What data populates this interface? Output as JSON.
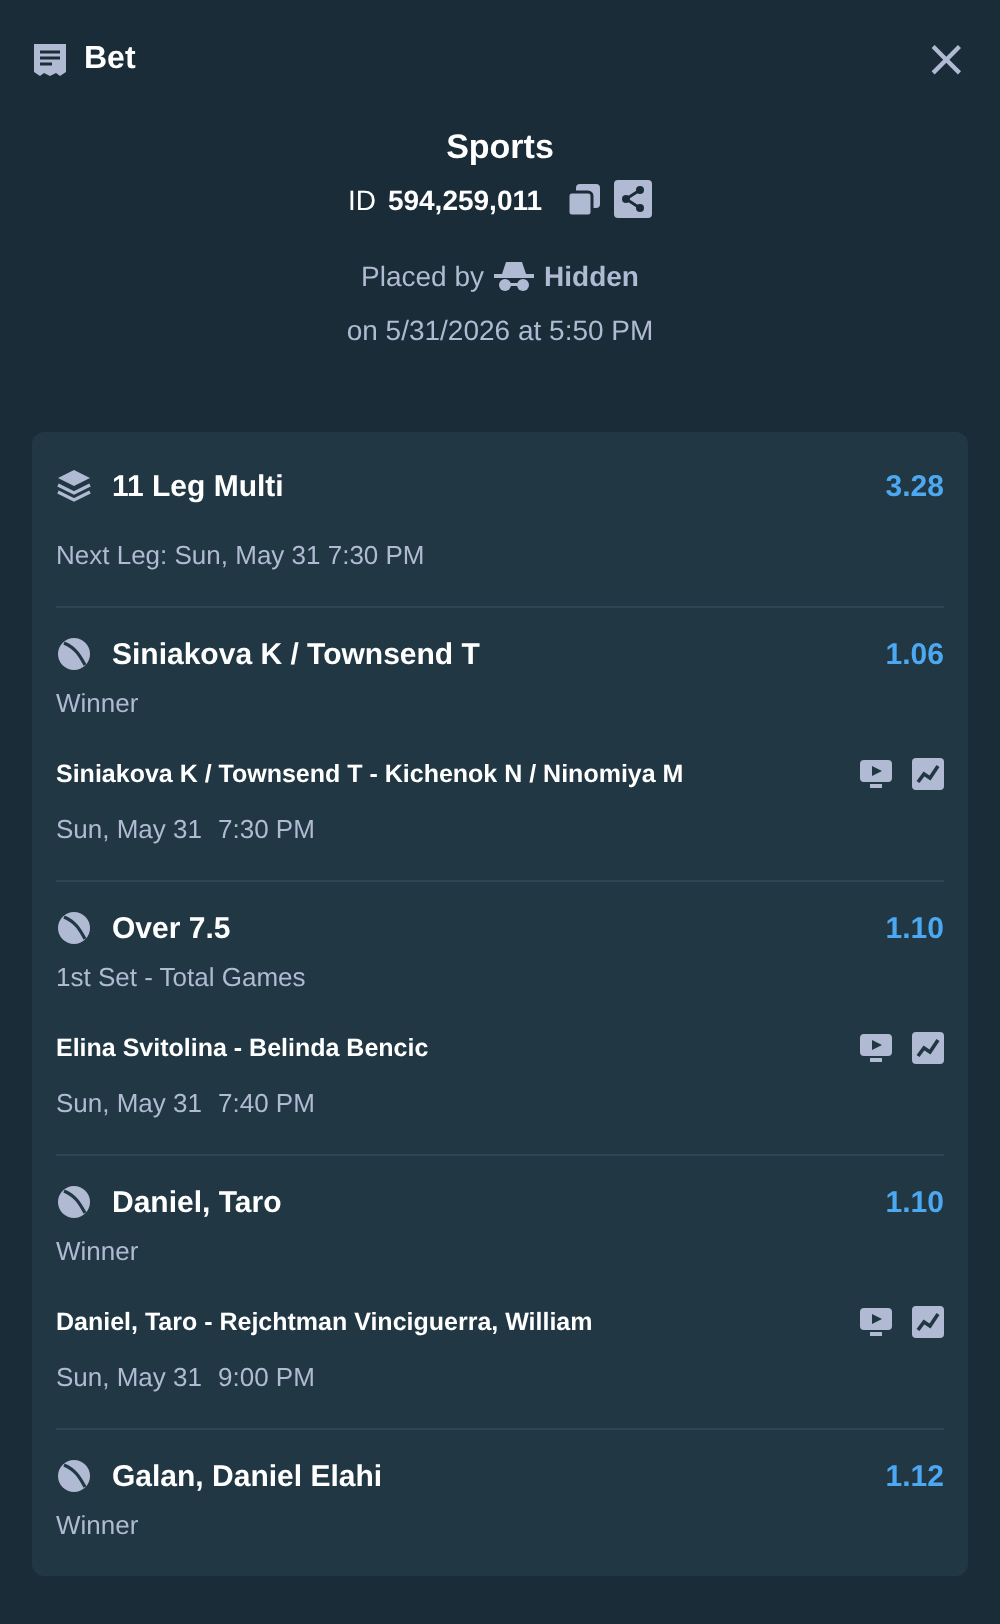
{
  "header": {
    "title": "Bet",
    "close": "×"
  },
  "summary": {
    "category": "Sports",
    "id_label": "ID",
    "id_value": "594,259,011",
    "placed_by_label": "Placed by",
    "placed_by": "Hidden",
    "placed_on": "on 5/31/2026 at 5:50 PM"
  },
  "multi": {
    "title": "11 Leg Multi",
    "odds": "3.28",
    "next_leg": "Next Leg: Sun, May 31 7:30 PM"
  },
  "legs": [
    {
      "selection": "Siniakova K / Townsend T",
      "odds": "1.06",
      "market": "Winner",
      "event": "Siniakova K / Townsend T - Kichenok N / Ninomiya M",
      "date": "Sun, May 31",
      "time": "7:30 PM"
    },
    {
      "selection": "Over 7.5",
      "odds": "1.10",
      "market": "1st Set - Total Games",
      "event": "Elina Svitolina - Belinda Bencic",
      "date": "Sun, May 31",
      "time": "7:40 PM"
    },
    {
      "selection": "Daniel, Taro",
      "odds": "1.10",
      "market": "Winner",
      "event": "Daniel, Taro - Rejchtman Vinciguerra, William",
      "date": "Sun, May 31",
      "time": "9:00 PM"
    },
    {
      "selection": "Galan, Daniel Elahi",
      "odds": "1.12",
      "market": "Winner"
    }
  ]
}
